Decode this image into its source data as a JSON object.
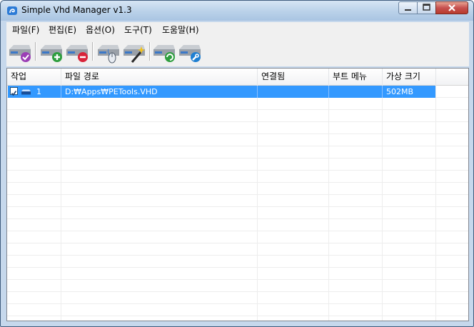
{
  "window": {
    "title": "Simple Vhd Manager v1.3",
    "accent": "#3399ff",
    "frame_color": "#c6d8ec"
  },
  "menu": [
    "파일(F)",
    "편집(E)",
    "옵션(O)",
    "도구(T)",
    "도움말(H)"
  ],
  "toolbar": {
    "buttons": [
      {
        "name": "attach-check-button",
        "icon": "disk-check-icon"
      },
      {
        "name": "add-vhd-button",
        "icon": "disk-add-icon"
      },
      {
        "name": "remove-vhd-button",
        "icon": "disk-remove-icon"
      },
      {
        "name": "boot-menu-button",
        "icon": "disk-mouse-icon"
      },
      {
        "name": "wizard-button",
        "icon": "disk-wand-icon"
      },
      {
        "name": "refresh-button",
        "icon": "disk-refresh-icon"
      },
      {
        "name": "settings-button",
        "icon": "disk-wrench-icon"
      }
    ]
  },
  "table": {
    "headers": [
      "작업",
      "파일 경로",
      "연결됨",
      "부트 메뉴",
      "가상 크기"
    ],
    "rows": [
      {
        "checked": true,
        "index": "1",
        "path": "D:₩Apps₩PETools.VHD",
        "attached": "",
        "boot_menu": "",
        "size": "502MB"
      }
    ]
  }
}
